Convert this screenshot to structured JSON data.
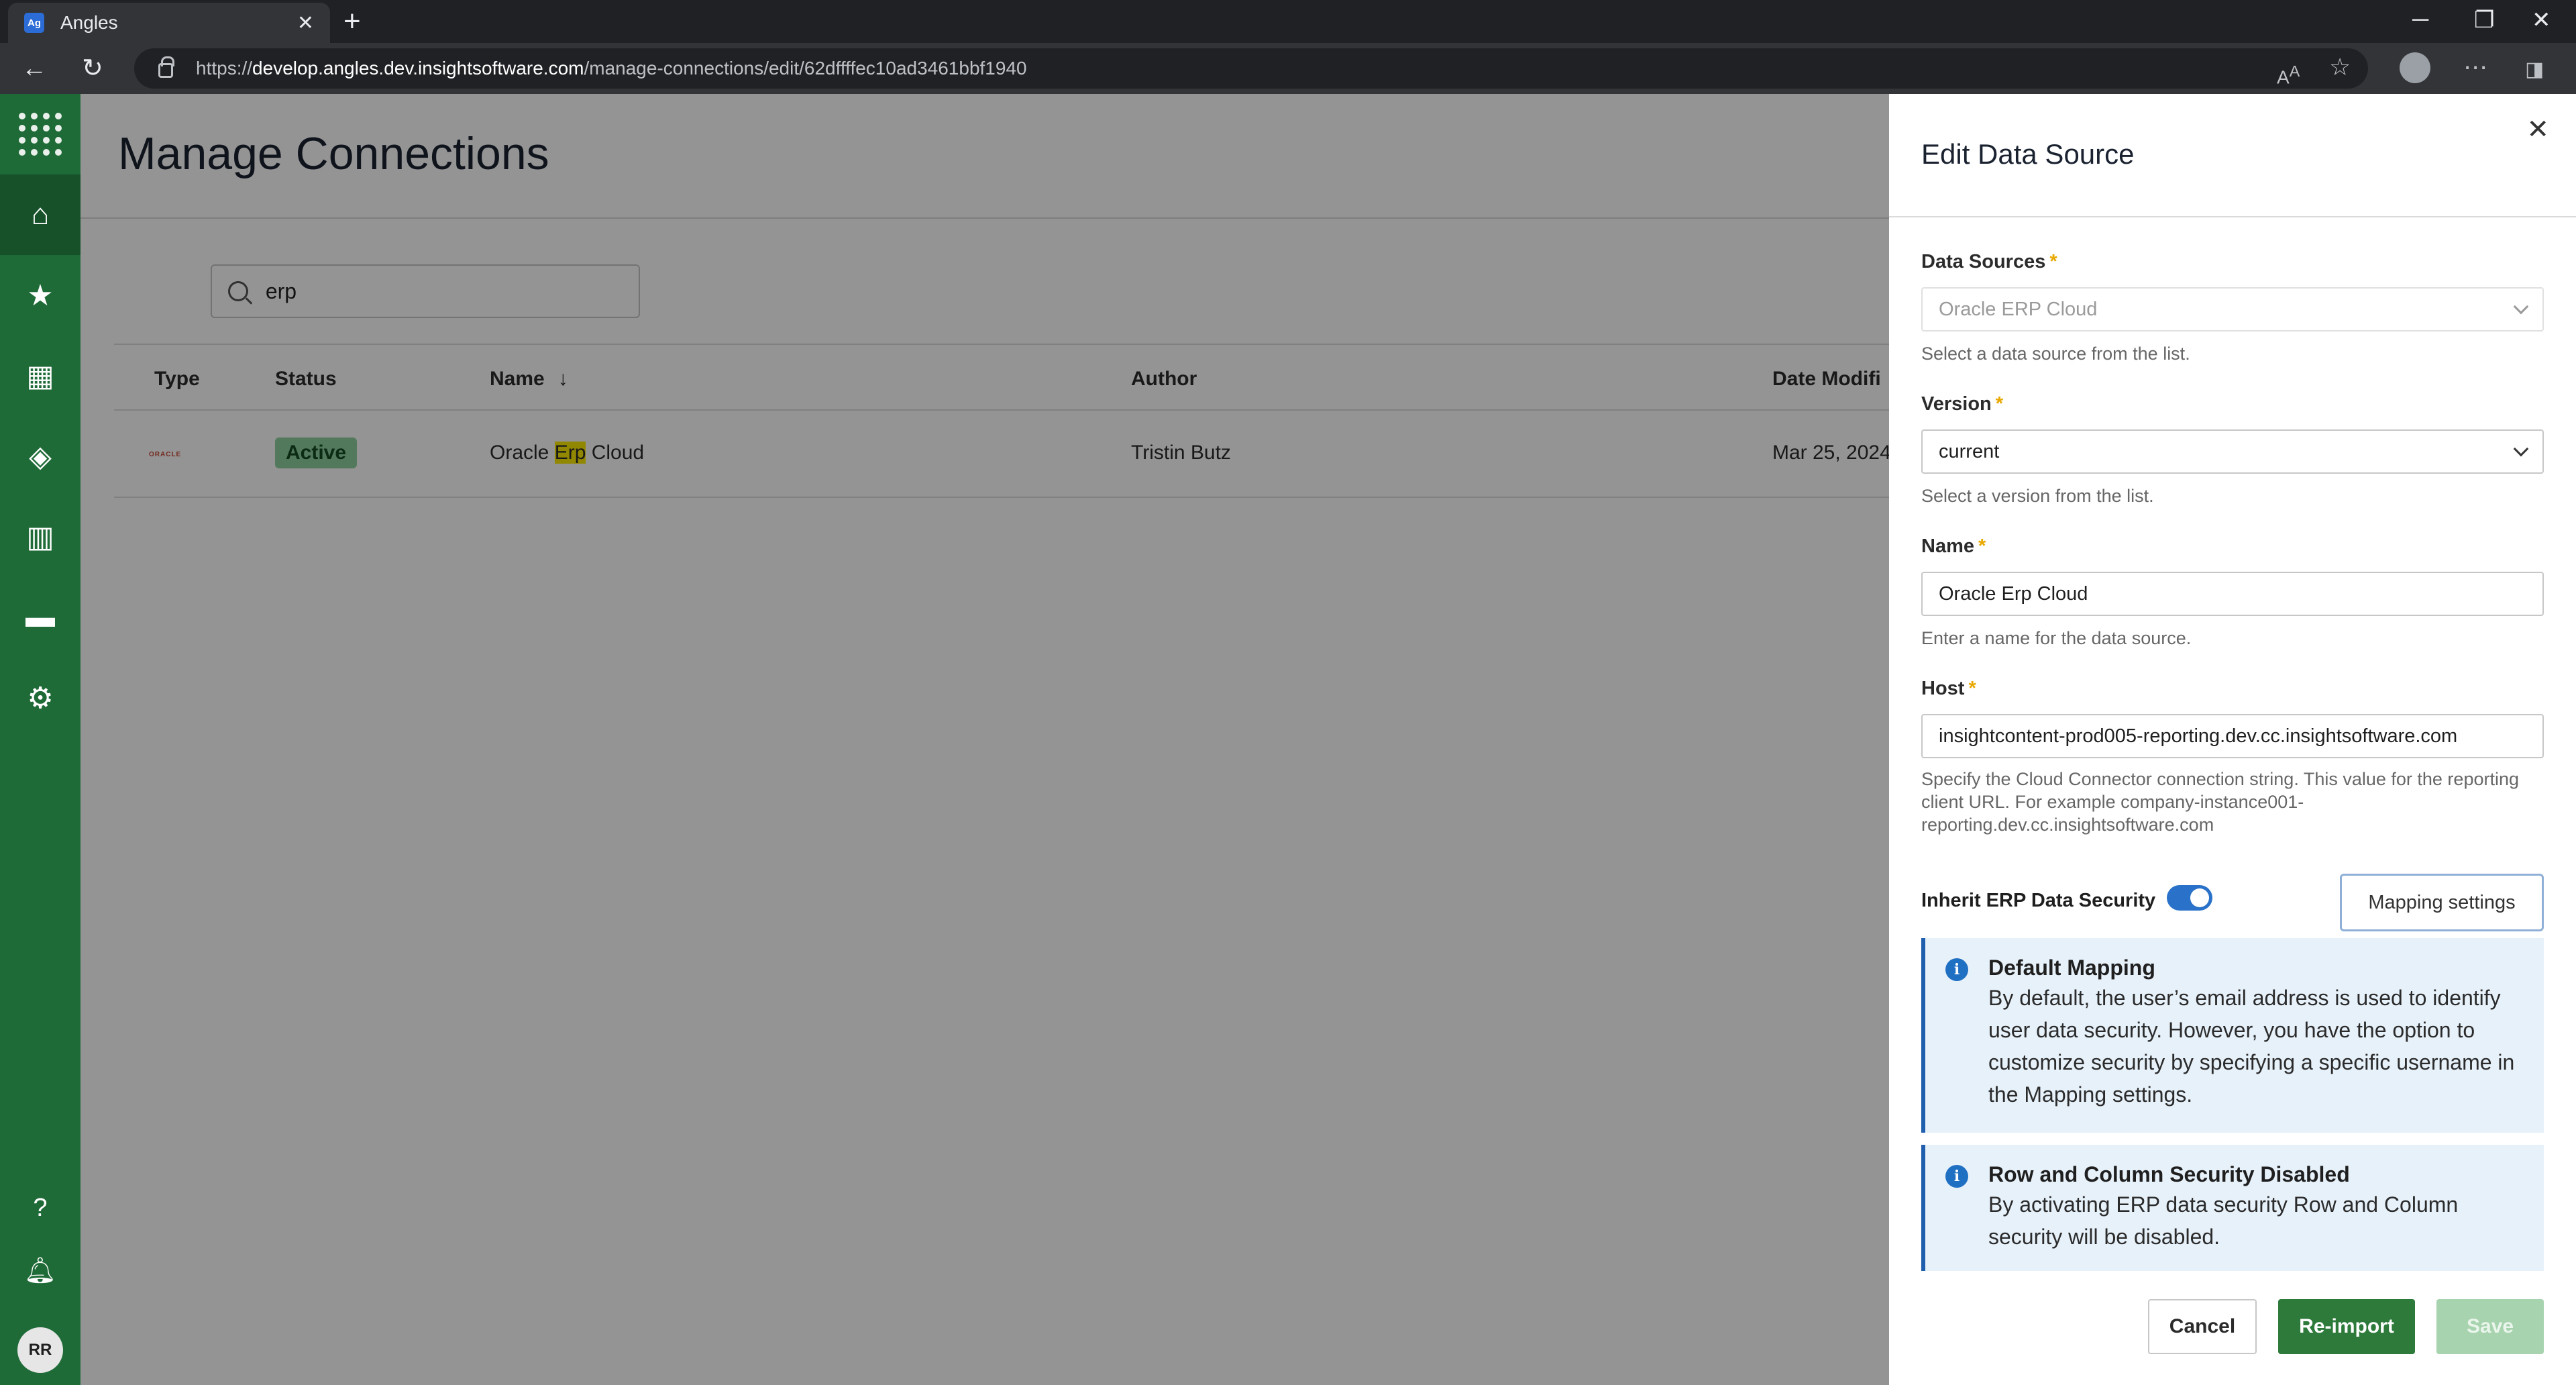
{
  "browser": {
    "tab_title": "Angles",
    "tab_favicon_text": "Ag",
    "url_prefix": "https://",
    "url_host": "develop.angles.dev.insightsoftware.com",
    "url_path": "/manage-connections/edit/62dffffec10ad3461bbf1940"
  },
  "sidebar": {
    "items": [
      "apps-grid",
      "home",
      "favorites",
      "dashboards",
      "layers",
      "reports",
      "folders",
      "settings",
      "help",
      "notifications"
    ],
    "avatar_initials": "RR"
  },
  "page": {
    "title": "Manage Connections",
    "search_value": "erp"
  },
  "table": {
    "columns": [
      "Type",
      "Status",
      "Name",
      "Author",
      "Date Modifi"
    ],
    "rows": [
      {
        "type_logo": "ORACLE",
        "status": "Active",
        "name_before": "Oracle ",
        "name_highlight": "Erp",
        "name_after": " Cloud",
        "author": "Tristin Butz",
        "date_modified": "Mar 25, 2024"
      }
    ]
  },
  "drawer": {
    "title": "Edit Data Source",
    "data_sources": {
      "label": "Data Sources",
      "value": "Oracle ERP Cloud",
      "help": "Select a data source from the list."
    },
    "version": {
      "label": "Version",
      "value": "current",
      "help": "Select a version from the list."
    },
    "name": {
      "label": "Name",
      "value": "Oracle Erp Cloud",
      "help": "Enter a name for the data source."
    },
    "host": {
      "label": "Host",
      "value": "insightcontent-prod005-reporting.dev.cc.insightsoftware.com",
      "help": "Specify the Cloud Connector connection string. This value for the reporting client URL. For example company-instance001-reporting.dev.cc.insightsoftware.com"
    },
    "required_mark": "*",
    "inherit_security_label": "Inherit ERP Data Security",
    "inherit_security_on": true,
    "mapping_settings_label": "Mapping settings",
    "info_default": {
      "title": "Default Mapping",
      "body": "By default, the user’s email address is used to identify user data security. However, you have the option to customize security by specifying a specific username in the Mapping settings."
    },
    "info_row_col": {
      "title": "Row and Column Security Disabled",
      "body": "By activating ERP data security Row and Column security will be disabled."
    },
    "buttons": {
      "cancel": "Cancel",
      "reimport": "Re-import",
      "save": "Save"
    }
  },
  "colors": {
    "sidebar": "#1f6b37",
    "primary_button": "#2d7a3a",
    "toggle": "#2a72c9",
    "info_border": "#1f5fae",
    "required": "#e8a800"
  }
}
